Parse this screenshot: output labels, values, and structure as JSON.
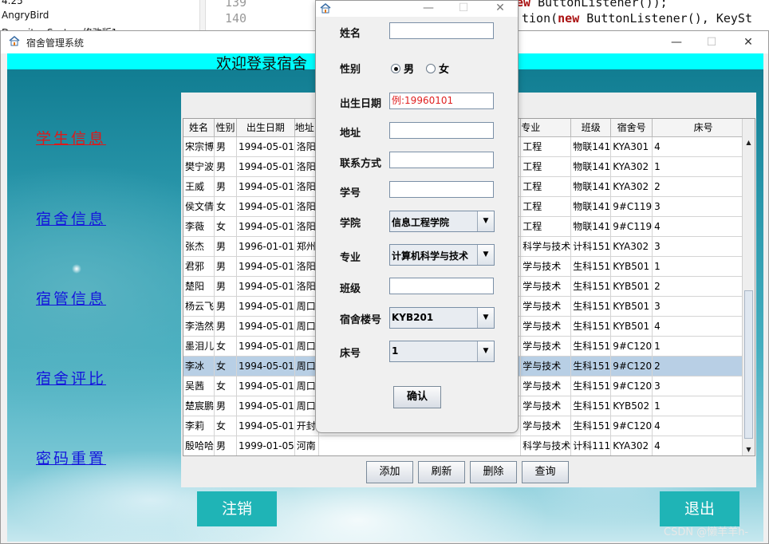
{
  "background": {
    "explorer_items": [
      "4.25",
      "AngryBird",
      "Dormitor-System修改版1"
    ],
    "editor_line_numbers": [
      "139",
      "140"
    ],
    "editor_lines": [
      {
        "kw": "new",
        "rest": " ButtonListener());"
      },
      {
        "pre": "tion(",
        "kw": "new",
        "rest": " ButtonListener(), KeySt"
      }
    ]
  },
  "main_window": {
    "title": "宿舍管理系统",
    "banner": "欢迎登录宿舍",
    "nav": [
      "学生信息",
      "宿舍信息",
      "宿管信息",
      "宿舍评比",
      "密码重置"
    ],
    "logout_label": "注销",
    "exit_label": "退出",
    "table": {
      "left_columns": [
        "姓名",
        "性别",
        "出生日期",
        "地址"
      ],
      "right_columns": [
        "专业",
        "班级",
        "宿舍号",
        "床号"
      ],
      "rows": [
        {
          "name": "宋宗博",
          "sex": "男",
          "birth": "1994-05-01",
          "addr": "洛阳",
          "major": "工程",
          "cls": "物联141",
          "dorm": "KYA301",
          "bed": "4"
        },
        {
          "name": "樊宁波",
          "sex": "男",
          "birth": "1994-05-01",
          "addr": "洛阳",
          "major": "工程",
          "cls": "物联141",
          "dorm": "KYA302",
          "bed": "1"
        },
        {
          "name": "王威",
          "sex": "男",
          "birth": "1994-05-01",
          "addr": "洛阳",
          "major": "工程",
          "cls": "物联141",
          "dorm": "KYA302",
          "bed": "2"
        },
        {
          "name": "侯文倩",
          "sex": "女",
          "birth": "1994-05-01",
          "addr": "洛阳",
          "major": "工程",
          "cls": "物联141",
          "dorm": "9#C119",
          "bed": "3"
        },
        {
          "name": "李薇",
          "sex": "女",
          "birth": "1994-05-01",
          "addr": "洛阳",
          "major": "工程",
          "cls": "物联141",
          "dorm": "9#C119",
          "bed": "4"
        },
        {
          "name": "张杰",
          "sex": "男",
          "birth": "1996-01-01",
          "addr": "郑州",
          "major": "科学与技术",
          "cls": "计科151",
          "dorm": "KYA302",
          "bed": "3"
        },
        {
          "name": "君邪",
          "sex": "男",
          "birth": "1994-05-01",
          "addr": "洛阳",
          "major": "学与技术",
          "cls": "生科151",
          "dorm": "KYB501",
          "bed": "1"
        },
        {
          "name": "楚阳",
          "sex": "男",
          "birth": "1994-05-01",
          "addr": "洛阳",
          "major": "学与技术",
          "cls": "生科151",
          "dorm": "KYB501",
          "bed": "2"
        },
        {
          "name": "杨云飞",
          "sex": "男",
          "birth": "1994-05-01",
          "addr": "周口",
          "major": "学与技术",
          "cls": "生科151",
          "dorm": "KYB501",
          "bed": "3"
        },
        {
          "name": "李浩然",
          "sex": "男",
          "birth": "1994-05-01",
          "addr": "周口",
          "major": "学与技术",
          "cls": "生科151",
          "dorm": "KYB501",
          "bed": "4"
        },
        {
          "name": "墨泪儿",
          "sex": "女",
          "birth": "1994-05-01",
          "addr": "周口",
          "major": "学与技术",
          "cls": "生科151",
          "dorm": "9#C120",
          "bed": "1"
        },
        {
          "name": "李冰",
          "sex": "女",
          "birth": "1994-05-01",
          "addr": "周口",
          "major": "学与技术",
          "cls": "生科151",
          "dorm": "9#C120",
          "bed": "2",
          "selected": true
        },
        {
          "name": "吴茜",
          "sex": "女",
          "birth": "1994-05-01",
          "addr": "周口",
          "major": "学与技术",
          "cls": "生科151",
          "dorm": "9#C120",
          "bed": "3"
        },
        {
          "name": "楚宸鹏",
          "sex": "男",
          "birth": "1994-05-01",
          "addr": "周口",
          "major": "学与技术",
          "cls": "生科151",
          "dorm": "KYB502",
          "bed": "1"
        },
        {
          "name": "李莉",
          "sex": "女",
          "birth": "1994-05-01",
          "addr": "开封",
          "major": "学与技术",
          "cls": "生科151",
          "dorm": "9#C120",
          "bed": "4"
        },
        {
          "name": "殷哈哈",
          "sex": "男",
          "birth": "1999-01-05",
          "addr": "河南",
          "major": "科学与技术",
          "cls": "计科111",
          "dorm": "KYA302",
          "bed": "4"
        }
      ]
    },
    "buttons": {
      "add": "添加",
      "refresh": "刷新",
      "delete": "删除",
      "query": "查询"
    }
  },
  "dialog": {
    "labels": {
      "name": "姓名",
      "sex": "性别",
      "birth": "出生日期",
      "address": "地址",
      "contact": "联系方式",
      "student_id": "学号",
      "college": "学院",
      "major": "专业",
      "class": "班级",
      "building": "宿舍楼号",
      "bed": "床号"
    },
    "sex_options": {
      "male": "男",
      "female": "女",
      "selected": "男"
    },
    "birth_hint": "例:19960101",
    "college_value": "信息工程学院",
    "major_value": "计算机科学与技术",
    "building_value": "KYB201",
    "bed_value": "1",
    "confirm_label": "确认"
  },
  "watermark": "CSDN @懒羊羊h-",
  "colors": {
    "banner": "#00ffff",
    "nav_active": "#e01818",
    "nav_link": "#1515dd",
    "action_button": "#1fb4b6",
    "selected_row": "#b8cfe5",
    "hint_text": "#e02020"
  }
}
